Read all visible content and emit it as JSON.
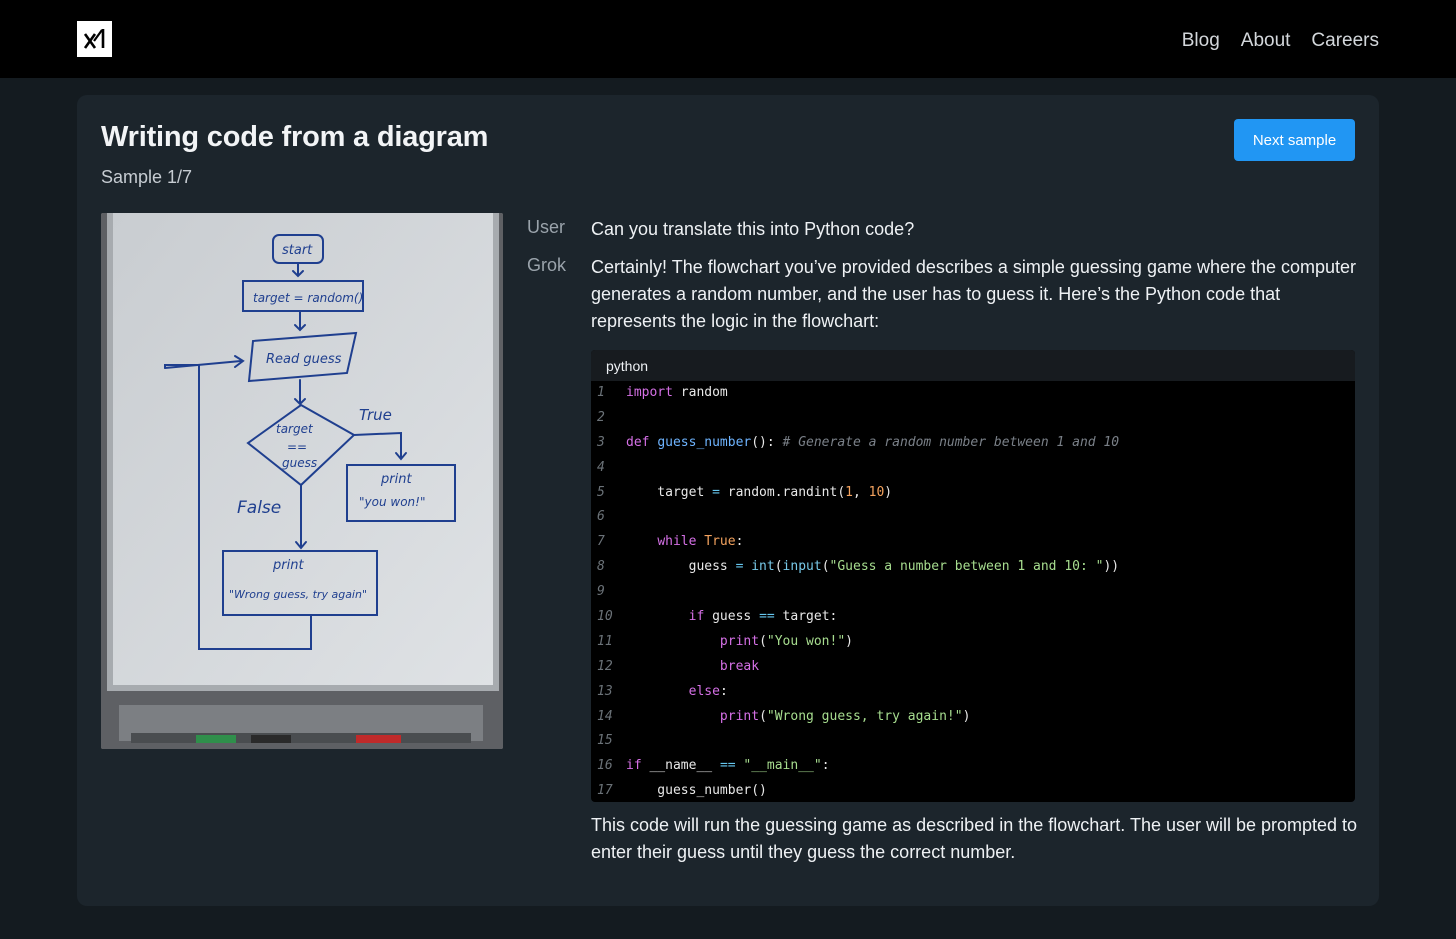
{
  "nav": {
    "blog": "Blog",
    "about": "About",
    "careers": "Careers"
  },
  "page": {
    "title": "Writing code from a diagram",
    "sample": "Sample 1/7",
    "next_label": "Next sample"
  },
  "whiteboard": {
    "start": "start",
    "target_assign": "target = random()",
    "read": "Read guess",
    "cond_1": "target",
    "cond_2": "==",
    "cond_3": "guess",
    "true": "True",
    "false": "False",
    "print_a": "print",
    "won": "\"you won!\"",
    "print_b": "print",
    "wrong": "\"Wrong guess, try again\""
  },
  "chat": {
    "user_role": "User",
    "grok_role": "Grok",
    "user_msg": "Can you translate this into Python code?",
    "grok_intro": "Certainly! The flowchart you’ve provided describes a simple guessing game where the computer generates a random number, and the user has to guess it. Here’s the Python code that represents the logic in the flowchart:",
    "grok_outro": "This code will run the guessing game as described in the flowchart. The user will be prompted to enter their guess until they guess the correct number."
  },
  "code": {
    "language": "python",
    "lines": [
      [
        [
          "kw",
          "import"
        ],
        [
          "tx",
          " random"
        ]
      ],
      [],
      [
        [
          "kw",
          "def"
        ],
        [
          "tx",
          " "
        ],
        [
          "fn",
          "guess_number"
        ],
        [
          "tx",
          "(): "
        ],
        [
          "cm",
          "# Generate a random number between 1 and 10"
        ]
      ],
      [],
      [
        [
          "tx",
          "    target "
        ],
        [
          "op",
          "="
        ],
        [
          "tx",
          " random.randint("
        ],
        [
          "num",
          "1"
        ],
        [
          "tx",
          ", "
        ],
        [
          "num",
          "10"
        ],
        [
          "tx",
          ")"
        ]
      ],
      [],
      [
        [
          "tx",
          "    "
        ],
        [
          "kw",
          "while"
        ],
        [
          "tx",
          " "
        ],
        [
          "true",
          "True"
        ],
        [
          "tx",
          ":"
        ]
      ],
      [
        [
          "tx",
          "        guess "
        ],
        [
          "op",
          "="
        ],
        [
          "tx",
          " "
        ],
        [
          "bi",
          "int"
        ],
        [
          "tx",
          "("
        ],
        [
          "bi",
          "input"
        ],
        [
          "tx",
          "("
        ],
        [
          "str",
          "\"Guess a number between 1 and 10: \""
        ],
        [
          "tx",
          "))"
        ]
      ],
      [],
      [
        [
          "tx",
          "        "
        ],
        [
          "kw",
          "if"
        ],
        [
          "tx",
          " guess "
        ],
        [
          "op",
          "=="
        ],
        [
          "tx",
          " target:"
        ]
      ],
      [
        [
          "tx",
          "            "
        ],
        [
          "kw",
          "print"
        ],
        [
          "tx",
          "("
        ],
        [
          "str",
          "\"You won!\""
        ],
        [
          "tx",
          ")"
        ]
      ],
      [
        [
          "tx",
          "            "
        ],
        [
          "kw",
          "break"
        ]
      ],
      [
        [
          "tx",
          "        "
        ],
        [
          "kw",
          "else"
        ],
        [
          "tx",
          ":"
        ]
      ],
      [
        [
          "tx",
          "            "
        ],
        [
          "kw",
          "print"
        ],
        [
          "tx",
          "("
        ],
        [
          "str",
          "\"Wrong guess, try again!\""
        ],
        [
          "tx",
          ")"
        ]
      ],
      [],
      [
        [
          "kw",
          "if"
        ],
        [
          "tx",
          " __name__ "
        ],
        [
          "op",
          "=="
        ],
        [
          "tx",
          " "
        ],
        [
          "str",
          "\"__main__\""
        ],
        [
          "tx",
          ":"
        ]
      ],
      [
        [
          "tx",
          "    guess_number()"
        ]
      ]
    ]
  }
}
